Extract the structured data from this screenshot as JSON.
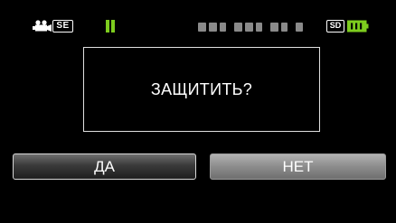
{
  "status_bar": {
    "camera_icon": "video-camera-icon",
    "mode_badge": "SE",
    "pause_icon": "pause-icon",
    "pause_color": "#7dcc1e",
    "timecode_icon": "masked-timecode",
    "sd_badge": "SD",
    "battery_icon": "battery-icon",
    "battery_color": "#7dcc1e"
  },
  "dialog": {
    "message": "ЗАЩИТИТЬ?"
  },
  "buttons": {
    "yes_label": "ДА",
    "no_label": "НЕТ"
  }
}
